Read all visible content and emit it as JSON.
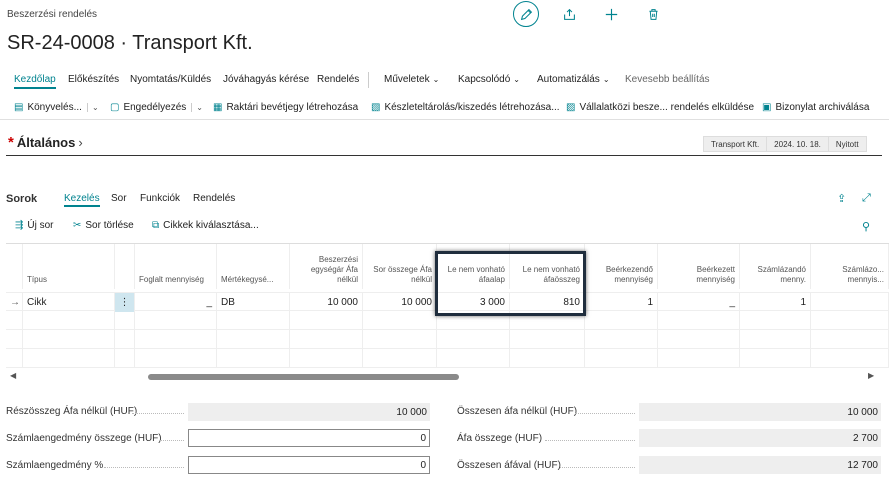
{
  "header": {
    "breadcrumb": "Beszerzési rendelés",
    "title": "SR-24-0008 · Transport Kft."
  },
  "tabs": [
    {
      "label": "Kezdőlap"
    },
    {
      "label": "Előkészítés"
    },
    {
      "label": "Nyomtatás/Küldés"
    },
    {
      "label": "Jóváhagyás kérése"
    },
    {
      "label": "Rendelés"
    },
    {
      "label": "Műveletek"
    },
    {
      "label": "Kapcsolódó"
    },
    {
      "label": "Automatizálás"
    },
    {
      "label": "Kevesebb beállítás"
    }
  ],
  "actions": {
    "posting": "Könyvelés...",
    "release": "Engedélyezés",
    "warehouse_receipt": "Raktári bevétjegy létrehozása",
    "put_away": "Készleteltárolás/kiszedés létrehozása...",
    "interco": "Vállalatközi besze... rendelés elküldése",
    "archive": "Bizonylat archiválása"
  },
  "general": {
    "title": "Általános",
    "chips": [
      "Transport Kft.",
      "2024. 10. 18.",
      "Nyitott"
    ]
  },
  "lines": {
    "title": "Sorok",
    "tabs": [
      "Kezelés",
      "Sor",
      "Funkciók",
      "Rendelés"
    ],
    "new_line": "Új sor",
    "delete_line": "Sor törlése",
    "select_items": "Cikkek kiválasztása..."
  },
  "table": {
    "headers": {
      "type": "Típus",
      "reserved_qty": "Foglalt mennyiség",
      "uom": "Mértékegysé...",
      "unit_cost": "Beszerzési egységár Áfa nélkül",
      "line_amount": "Sor összege Áfa nélkül",
      "nondeduct_base": "Le nem vonható áfaalap",
      "nondeduct_amount": "Le nem vonható áfaösszeg",
      "qty_to_receive": "Beérkezendő mennyiség",
      "qty_received": "Beérkezett mennyiség",
      "qty_to_invoice": "Számlázandó menny.",
      "qty_invoiced": "Számlázo... mennyis..."
    },
    "row": {
      "type": "Cikk",
      "reserved_qty": "_",
      "uom": "DB",
      "unit_cost": "10 000",
      "line_amount": "10 000",
      "nondeduct_base": "3 000",
      "nondeduct_amount": "810",
      "qty_to_receive": "1",
      "qty_received": "_",
      "qty_to_invoice": "1",
      "qty_invoiced": ""
    }
  },
  "totals": {
    "subtotal_excl_vat_label": "Részösszeg Áfa nélkül (HUF)",
    "subtotal_excl_vat": "10 000",
    "invoice_discount_amount_label": "Számlaengedmény összege (HUF)",
    "invoice_discount_amount": "0",
    "invoice_discount_pct_label": "Számlaengedmény %",
    "invoice_discount_pct": "0",
    "total_excl_vat_label": "Összesen áfa nélkül (HUF)",
    "total_excl_vat": "10 000",
    "vat_amount_label": "Áfa összege (HUF)",
    "vat_amount": "2 700",
    "total_incl_vat_label": "Összesen áfával (HUF)",
    "total_incl_vat": "12 700"
  },
  "colors": {
    "accent": "#00838f",
    "required": "#cc0000"
  }
}
